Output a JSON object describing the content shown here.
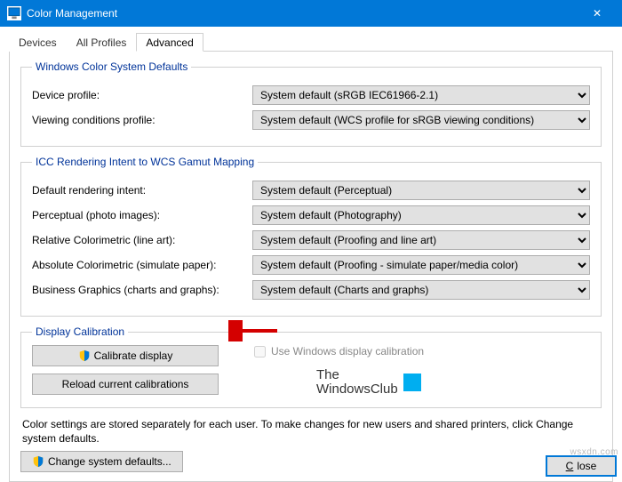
{
  "window": {
    "title": "Color Management",
    "close_glyph": "✕"
  },
  "tabs": {
    "devices": "Devices",
    "all_profiles": "All Profiles",
    "advanced": "Advanced"
  },
  "groups": {
    "wcs": {
      "legend": "Windows Color System Defaults",
      "device_profile_label": "Device profile:",
      "device_profile_value": "System default (sRGB IEC61966-2.1)",
      "viewing_label": "Viewing conditions profile:",
      "viewing_value": "System default (WCS profile for sRGB viewing conditions)"
    },
    "icc": {
      "legend": "ICC Rendering Intent to WCS Gamut Mapping",
      "default_intent_label": "Default rendering intent:",
      "default_intent_value": "System default (Perceptual)",
      "perceptual_label": "Perceptual (photo images):",
      "perceptual_value": "System default (Photography)",
      "relcol_label": "Relative Colorimetric (line art):",
      "relcol_value": "System default (Proofing and line art)",
      "abscol_label": "Absolute Colorimetric (simulate paper):",
      "abscol_value": "System default (Proofing - simulate paper/media color)",
      "biz_label": "Business Graphics (charts and graphs):",
      "biz_value": "System default (Charts and graphs)"
    },
    "calib": {
      "legend": "Display Calibration",
      "calibrate_btn": "Calibrate display",
      "reload_btn": "Reload current calibrations",
      "use_win_calib": "Use Windows display calibration",
      "wclub_line1": "The",
      "wclub_line2": "WindowsClub"
    }
  },
  "note": "Color settings are stored separately for each user. To make changes for new users and shared printers, click Change system defaults.",
  "change_defaults_btn": "Change system defaults...",
  "close_btn": "Close",
  "watermark": "wsxdn.com"
}
